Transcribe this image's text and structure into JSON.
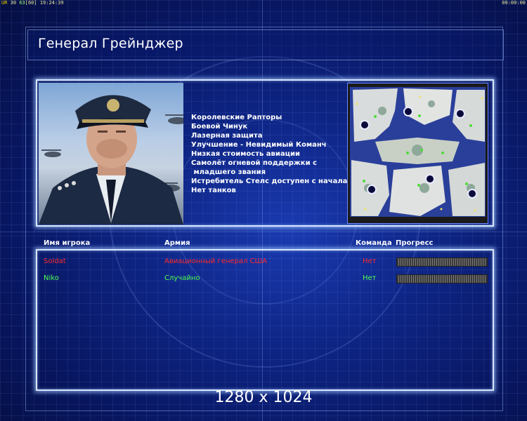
{
  "hud": {
    "left_prefix": "UR",
    "left_fps": "30",
    "left_value": "63",
    "left_bracket": "[60]",
    "left_time": "19:24:39",
    "right_time": "00:00:00"
  },
  "header": {
    "title": "Генерал Грейнджер"
  },
  "general": {
    "perks": [
      "Королевские Рапторы",
      "Боевой Чинук",
      "Лазерная защита",
      "Улучшение - Невидимый Команч",
      "Низкая стоимость авиации",
      "Самолёт огневой поддержки с",
      " младшего звания",
      "Истребитель Стелс доступен с начала",
      "Нет танков"
    ]
  },
  "players": {
    "headers": {
      "name": "Имя игрока",
      "army": "Армия",
      "team": "Команда",
      "progress": "Прогресс"
    },
    "rows": [
      {
        "name": "Soldat",
        "army": "Авиационный генерал США",
        "team": "Нет",
        "color": "#ff2a2a"
      },
      {
        "name": "Niko",
        "army": "Случайно",
        "team": "Нет",
        "color": "#50ff50"
      }
    ]
  },
  "footer": {
    "resolution": "1280 x 1024"
  },
  "colors": {
    "background": "#0a1a6a",
    "panel_border": "#d8e6ff",
    "player1": "#ff2a2a",
    "player2": "#50ff50"
  },
  "icons": [
    "crosshair-icon",
    "general-portrait-image",
    "minimap-image",
    "progress-bar"
  ]
}
